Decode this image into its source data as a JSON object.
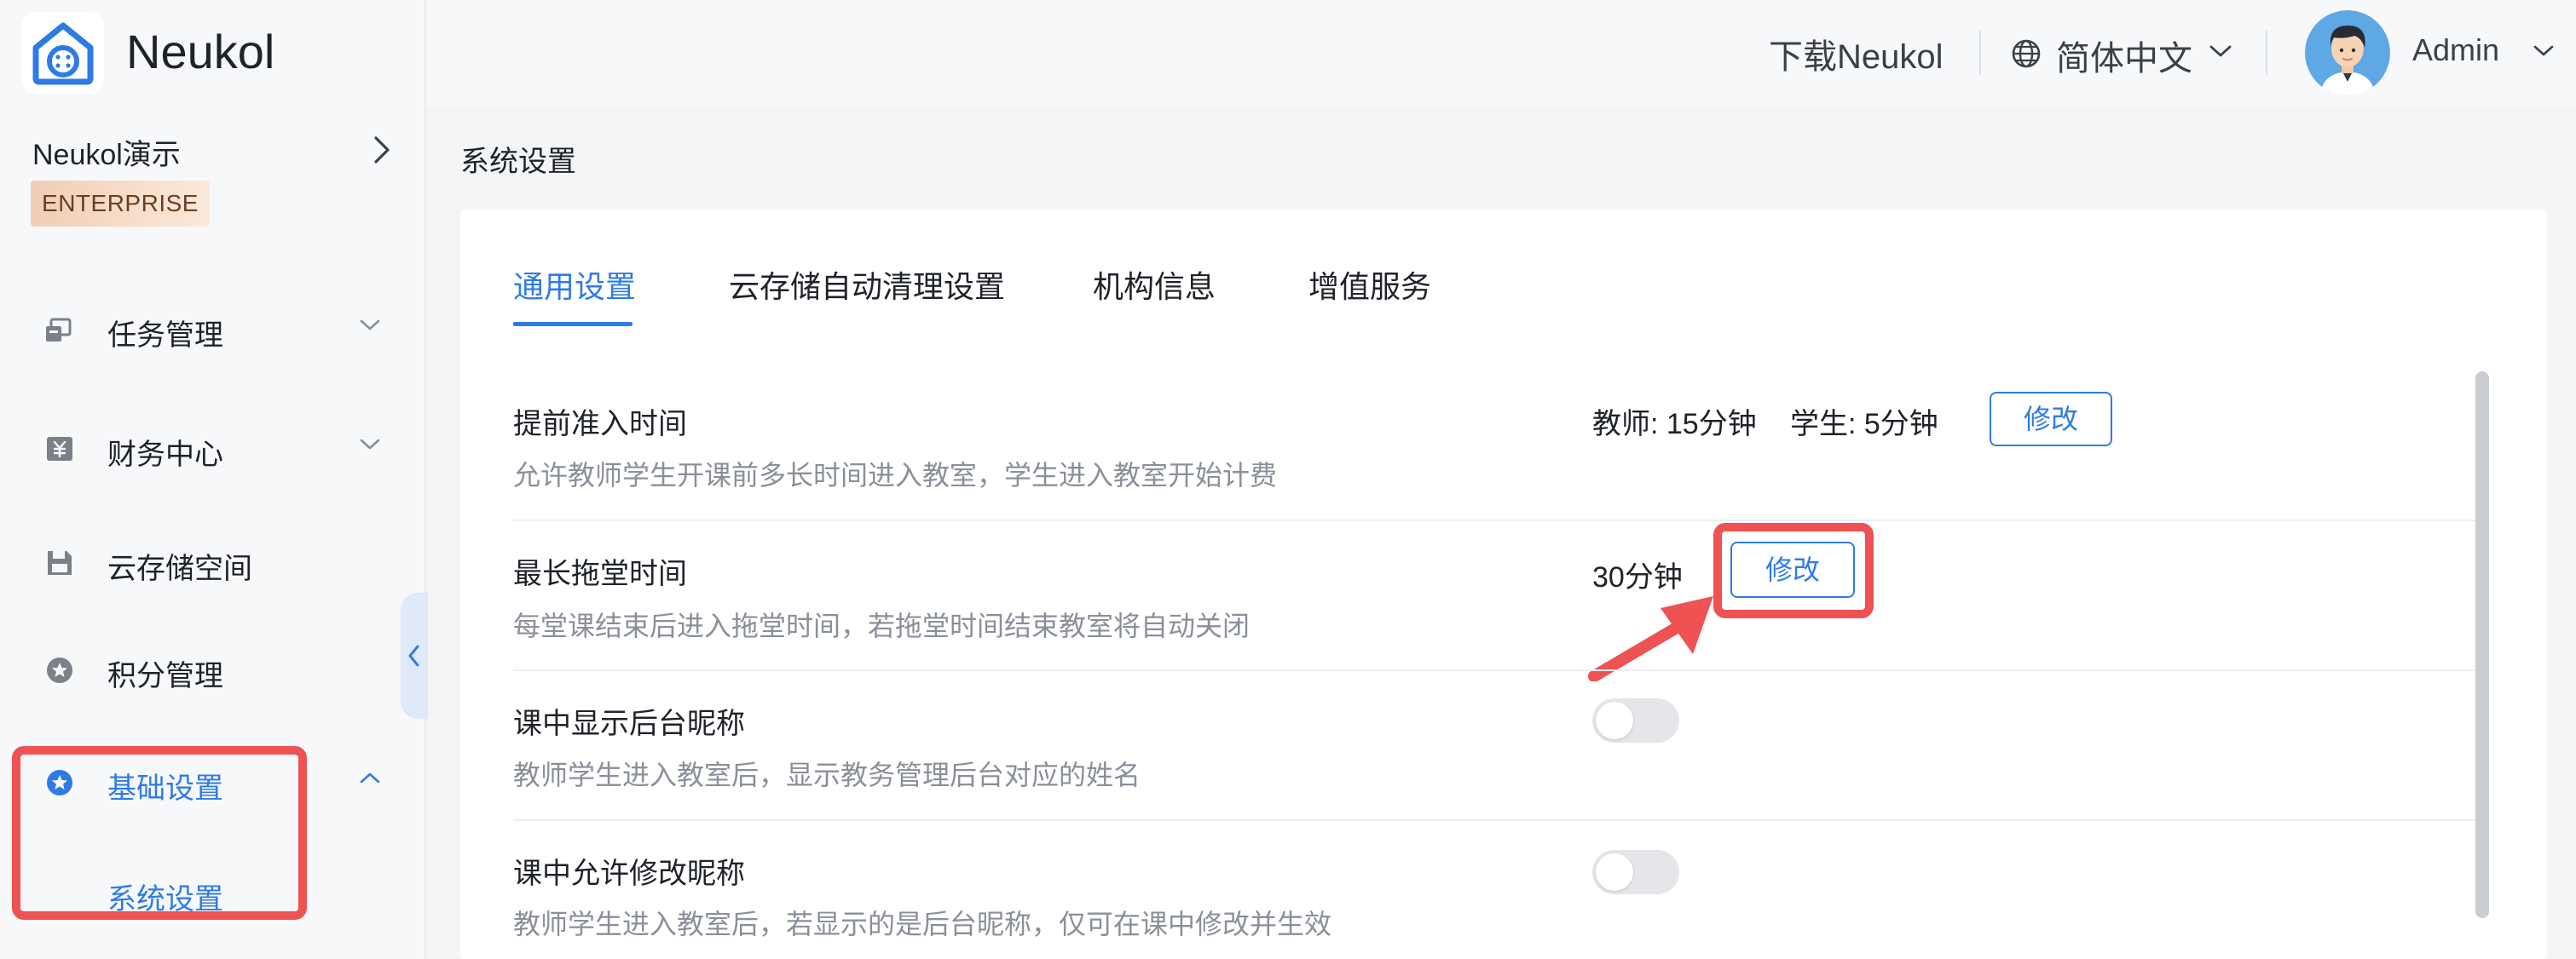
{
  "brand": {
    "name": "Neukol"
  },
  "sidebar": {
    "org_name": "Neukol演示",
    "badge": "ENTERPRISE",
    "items": [
      {
        "label": "任务管理",
        "icon": "task-icon"
      },
      {
        "label": "财务中心",
        "icon": "finance-icon"
      },
      {
        "label": "云存储空间",
        "icon": "cloud-storage-icon"
      },
      {
        "label": "积分管理",
        "icon": "points-icon"
      },
      {
        "label": "基础设置",
        "icon": "basic-settings-icon",
        "active": true
      }
    ],
    "sub_item": "系统设置"
  },
  "header": {
    "download": "下载Neukol",
    "language": "简体中文",
    "user": "Admin"
  },
  "page": {
    "title": "系统设置",
    "tabs": [
      "通用设置",
      "云存储自动清理设置",
      "机构信息",
      "增值服务"
    ],
    "active_tab": 0
  },
  "settings": [
    {
      "title": "提前准入时间",
      "desc": "允许教师学生开课前多长时间进入教室，学生进入教室开始计费",
      "teacher": "教师: 15分钟",
      "student": "学生: 5分钟",
      "action": "修改"
    },
    {
      "title": "最长拖堂时间",
      "desc": "每堂课结束后进入拖堂时间，若拖堂时间结束教室将自动关闭",
      "value": "30分钟",
      "action": "修改"
    },
    {
      "title": "课中显示后台昵称",
      "desc": "教师学生进入教室后，显示教务管理后台对应的姓名",
      "enabled": false
    },
    {
      "title": "课中允许修改昵称",
      "desc": "教师学生进入教室后，若显示的是后台昵称，仅可在课中修改并生效",
      "enabled": false
    }
  ],
  "colors": {
    "accent": "#2e7be6",
    "highlight": "#ee5252",
    "badge_bg": "#f3d3bd"
  }
}
